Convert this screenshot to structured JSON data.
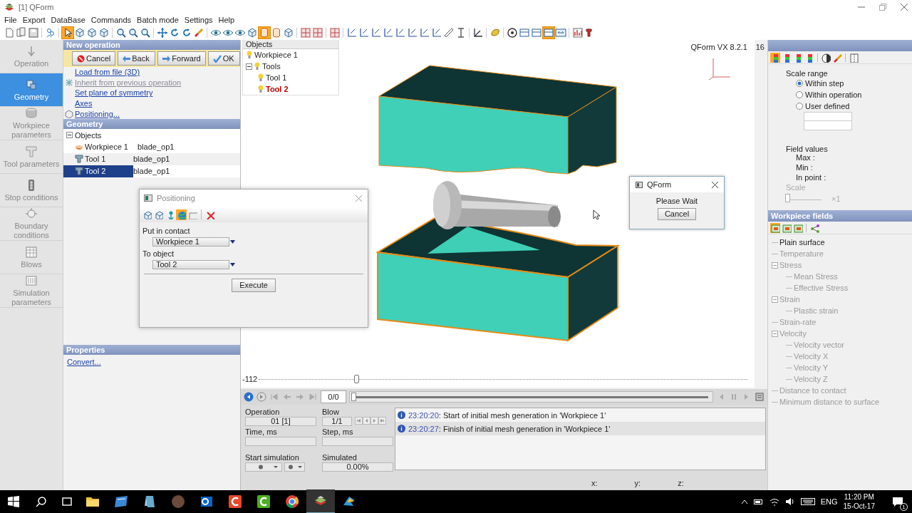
{
  "window": {
    "title": "[1] QForm"
  },
  "menu": [
    "File",
    "Export",
    "DataBase",
    "Commands",
    "Batch mode",
    "Settings",
    "Help"
  ],
  "toolbar": [
    {
      "selected": false
    },
    {
      "selected": false
    },
    {
      "selected": false
    },
    {
      "selected": false
    },
    {
      "selected": true
    },
    {
      "selected": false
    },
    {
      "selected": false
    },
    {
      "selected": false
    },
    {
      "selected": false
    },
    {
      "selected": false
    },
    {
      "selected": false
    },
    {
      "selected": false
    },
    {
      "selected": false
    },
    {
      "selected": false
    },
    {
      "selected": false
    },
    {
      "selected": false
    },
    {
      "selected": false
    },
    {
      "selected": false
    },
    {
      "selected": false
    },
    {
      "selected": true
    },
    {
      "selected": false
    },
    {
      "selected": false
    },
    {
      "selected": false
    },
    {
      "selected": false
    },
    {
      "selected": false
    },
    {
      "selected": false
    },
    {
      "selected": false
    },
    {
      "selected": false
    },
    {
      "selected": false
    },
    {
      "selected": false
    },
    {
      "selected": false
    },
    {
      "selected": false
    },
    {
      "selected": false
    },
    {
      "selected": false
    },
    {
      "selected": false
    },
    {
      "selected": false
    },
    {
      "selected": false
    },
    {
      "selected": false
    },
    {
      "selected": false
    },
    {
      "selected": false
    },
    {
      "selected": true
    },
    {
      "selected": false
    },
    {
      "selected": false
    },
    {
      "selected": false
    }
  ],
  "nav": [
    {
      "label": "Operation",
      "selected": false
    },
    {
      "label": "Geometry",
      "selected": true
    },
    {
      "label": "Workpiece parameters",
      "selected": false
    },
    {
      "label": "Tool parameters",
      "selected": false
    },
    {
      "label": "Stop conditions",
      "selected": false
    },
    {
      "label": "Boundary conditions",
      "selected": false
    },
    {
      "label": "Blows",
      "selected": false
    },
    {
      "label": "Simulation parameters",
      "selected": false
    }
  ],
  "new_operation": {
    "title": "New operation",
    "buttons": [
      "Cancel",
      "Back",
      "Forward",
      "OK"
    ],
    "links": [
      {
        "label": "Load from file (3D)",
        "disabled": false
      },
      {
        "label": "Inherit from previous operation",
        "disabled": true
      },
      {
        "label": "Set plane of symmetry",
        "disabled": false
      },
      {
        "label": "Axes",
        "disabled": false
      },
      {
        "label": "Positioning...",
        "disabled": false
      }
    ]
  },
  "geometry": {
    "title": "Geometry",
    "tree": {
      "label": "Objects",
      "expanded": true,
      "children": [
        {
          "label": "Workpiece 1",
          "file": "blade_op1",
          "selected": false
        },
        {
          "label": "Tool 1",
          "file": "blade_op1",
          "selected": false
        },
        {
          "label": "Tool 2",
          "file": "blade_op1",
          "selected": true
        }
      ]
    }
  },
  "properties": {
    "title": "Properties",
    "link": "Convert..."
  },
  "viewport": {
    "objects_tree": {
      "label": "Objects",
      "children": [
        {
          "label": "Workpiece 1",
          "selected": false
        },
        {
          "label": "Tools",
          "expanded": true,
          "selected": false,
          "children": [
            {
              "label": "Tool 1",
              "selected": false
            },
            {
              "label": "Tool 2",
              "selected": true
            }
          ]
        }
      ]
    },
    "version": "QForm VX 8.2.1",
    "counter": "16"
  },
  "section_slider": {
    "reading": "-112",
    "level": 0.2
  },
  "playback": {
    "frame": "0/0",
    "level": 0
  },
  "fields": [
    {
      "label": "Operation",
      "value": "01 [1]"
    },
    {
      "label": "Blow",
      "value": "1/1"
    },
    {
      "label": "Time, ms"
    },
    {
      "label": "Step, ms"
    }
  ],
  "start_simulation": {
    "label": "Start simulation"
  },
  "simulated": {
    "label": "Simulated",
    "value": "0.00%"
  },
  "log": [
    {
      "time": "23:20:20",
      "text": ": Start of initial mesh generation in 'Workpiece 1'",
      "selected": false
    },
    {
      "time": "23:20:27",
      "text": ": Finish of initial mesh generation in 'Workpiece 1'",
      "selected": true
    }
  ],
  "status": [
    "x:",
    "y:",
    "z:"
  ],
  "right_panel": {
    "toolbar": [
      {
        "selected": true
      },
      {
        "selected": false
      },
      {
        "selected": false
      },
      {
        "selected": false
      },
      {
        "selected": false
      },
      {
        "selected": false
      },
      {
        "selected": false
      }
    ],
    "scale_range": {
      "title": "Scale range",
      "options": [
        {
          "label": "Within step",
          "selected": true
        },
        {
          "label": "Within operation",
          "selected": false
        },
        {
          "label": "User defined",
          "selected": false
        }
      ]
    },
    "field_values": {
      "title": "Field values",
      "rows": [
        "Max :",
        "Min :",
        "In point :"
      ]
    },
    "scale": {
      "label": "Scale",
      "reading": "×1",
      "level": 0,
      "disabled": true
    },
    "fields_title": "Workpiece fields",
    "fields_toolbar": [
      {
        "selected": true
      },
      {
        "selected": false
      },
      {
        "selected": false
      },
      {
        "selected": false
      }
    ],
    "fields_tree": [
      {
        "label": "Plain surface",
        "disabled": false
      },
      {
        "label": "Temperature",
        "disabled": true
      },
      {
        "label": "Stress",
        "disabled": true,
        "expanded": true,
        "children": [
          {
            "label": "Mean Stress",
            "disabled": true
          },
          {
            "label": "Effective Stress",
            "disabled": true
          }
        ]
      },
      {
        "label": "Strain",
        "disabled": true,
        "expanded": true,
        "children": [
          {
            "label": "Plastic strain",
            "disabled": true
          }
        ]
      },
      {
        "label": "Strain-rate",
        "disabled": true
      },
      {
        "label": "Velocity",
        "disabled": true,
        "expanded": true,
        "children": [
          {
            "label": "Velocity vector",
            "disabled": true
          },
          {
            "label": "Velocity X",
            "disabled": true
          },
          {
            "label": "Velocity Y",
            "disabled": true
          },
          {
            "label": "Velocity Z",
            "disabled": true
          }
        ]
      },
      {
        "label": "Distance to contact",
        "disabled": true
      },
      {
        "label": "Minimum distance to surface",
        "disabled": true
      }
    ]
  },
  "positioning_dialog": {
    "title": "Positioning",
    "toolbar": [
      {
        "selected": false
      },
      {
        "selected": false
      },
      {
        "selected": false
      },
      {
        "selected": true
      },
      {
        "selected": false
      },
      {
        "selected": false
      }
    ],
    "contact_label": "Put in contact",
    "contact_value": "Workpiece 1",
    "object_label": "To object",
    "object_value": "Tool 2",
    "button": "Execute"
  },
  "wait_dialog": {
    "title": "QForm",
    "message": "Please Wait",
    "button": "Cancel"
  },
  "taskbar": {
    "apps": [
      {
        "active": false
      },
      {
        "active": false
      },
      {
        "active": false
      },
      {
        "active": false
      },
      {
        "active": false
      },
      {
        "active": false
      },
      {
        "active": false
      },
      {
        "active": false
      },
      {
        "active": true
      },
      {
        "active": false
      }
    ],
    "language": "ENG",
    "time": "11:20 PM",
    "date": "15-Oct-17",
    "notifications": "1"
  }
}
